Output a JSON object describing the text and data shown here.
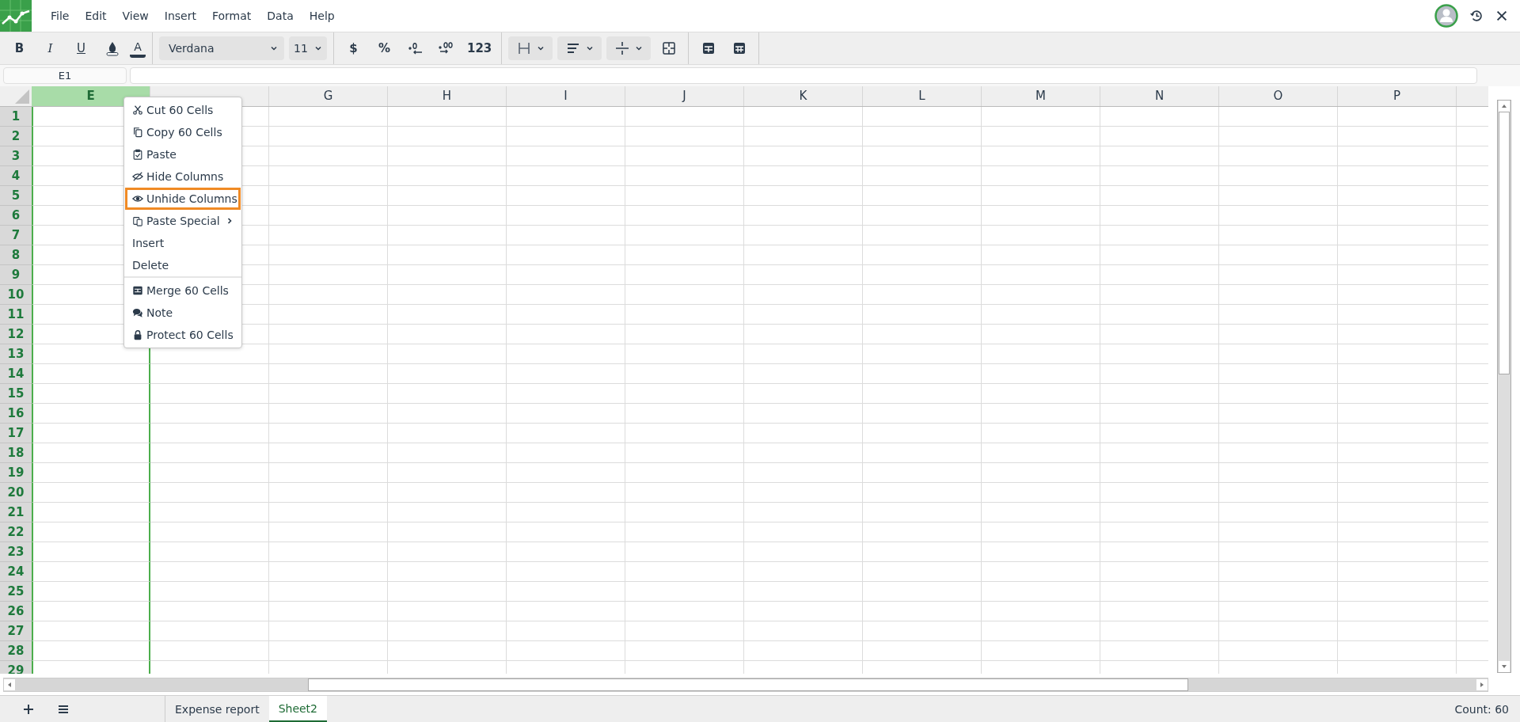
{
  "menubar": {
    "items": [
      "File",
      "Edit",
      "View",
      "Insert",
      "Format",
      "Data",
      "Help"
    ]
  },
  "toolbar": {
    "groups": [
      [
        {
          "kind": "bold",
          "label": "B"
        },
        {
          "kind": "italic",
          "label": "I"
        },
        {
          "kind": "underline",
          "label": "U"
        },
        {
          "kind": "fill-color"
        },
        {
          "kind": "text-color",
          "label": "A"
        }
      ],
      [
        {
          "kind": "font-select",
          "value": "Verdana"
        },
        {
          "kind": "size-select",
          "value": "11"
        }
      ],
      [
        {
          "kind": "symbol",
          "label": "$"
        },
        {
          "kind": "symbol",
          "label": "%"
        },
        {
          "kind": "decrease-decimals"
        },
        {
          "kind": "increase-decimals"
        },
        {
          "kind": "symbol",
          "label": "123"
        }
      ],
      [
        {
          "kind": "borders-select"
        },
        {
          "kind": "align-select"
        },
        {
          "kind": "valign-select"
        },
        {
          "kind": "merge"
        }
      ],
      [
        {
          "kind": "table-rows"
        },
        {
          "kind": "table-grid"
        }
      ]
    ]
  },
  "name_box": {
    "value": "E1"
  },
  "sheet": {
    "columns": [
      {
        "label": "E",
        "selected": true
      },
      {
        "selected": false
      },
      {
        "label": "G",
        "selected": false
      },
      {
        "label": "H",
        "selected": false
      },
      {
        "label": "I",
        "selected": false
      },
      {
        "label": "J",
        "selected": false
      },
      {
        "label": "K",
        "selected": false
      },
      {
        "label": "L",
        "selected": false
      },
      {
        "label": "M",
        "selected": false
      },
      {
        "label": "N",
        "selected": false
      },
      {
        "label": "O",
        "selected": false
      },
      {
        "label": "P",
        "selected": false
      }
    ],
    "rows": [
      "1",
      "2",
      "3",
      "4",
      "5",
      "6",
      "7",
      "8",
      "9",
      "10",
      "11",
      "12",
      "13",
      "14",
      "15",
      "16",
      "17",
      "18",
      "19",
      "20",
      "21",
      "22",
      "23",
      "24",
      "25",
      "26",
      "27",
      "28",
      "29"
    ]
  },
  "context_menu": {
    "groups": [
      [
        {
          "kind": "cut",
          "label": "Cut 60 Cells",
          "selected": false
        },
        {
          "kind": "copy",
          "label": "Copy 60 Cells",
          "selected": false
        },
        {
          "kind": "paste",
          "label": "Paste",
          "selected": false
        },
        {
          "kind": "hide",
          "label": "Hide Columns",
          "selected": false
        },
        {
          "kind": "unhide",
          "label": "Unhide Columns",
          "selected": true
        },
        {
          "kind": "paste-special",
          "label": "Paste Special",
          "selected": false,
          "submenu": true
        },
        {
          "kind": "plain",
          "label": "Insert",
          "selected": false
        },
        {
          "kind": "plain",
          "label": "Delete",
          "selected": false
        }
      ],
      [
        {
          "kind": "merge",
          "label": "Merge 60 Cells",
          "selected": false
        },
        {
          "kind": "note",
          "label": "Note",
          "selected": false
        },
        {
          "kind": "lock",
          "label": "Protect 60 Cells",
          "selected": false
        }
      ]
    ]
  },
  "sheet_tabs": [
    {
      "label": "Expense report",
      "selected": false
    },
    {
      "label": "Sheet2",
      "selected": true
    }
  ],
  "status_bar": {
    "text": "Count: 60"
  }
}
